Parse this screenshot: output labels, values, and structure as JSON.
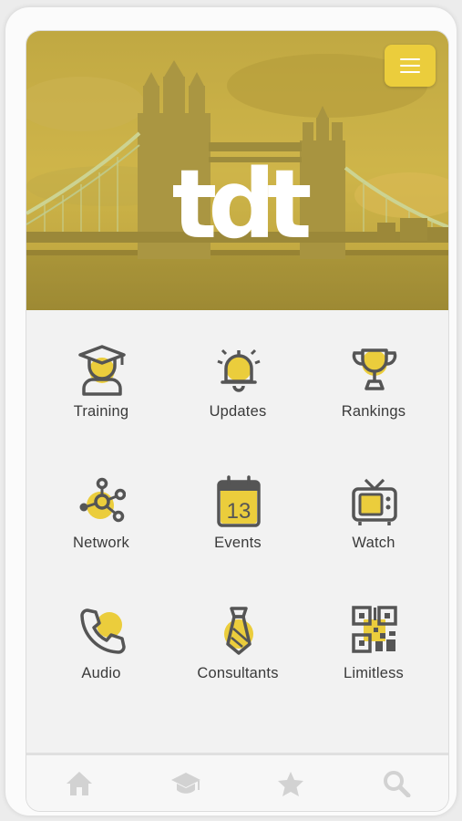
{
  "brand": {
    "logo_text": "tdt",
    "accent": "#ebcd3c",
    "icon_color": "#555555"
  },
  "header": {
    "menu_icon": "hamburger-menu-icon"
  },
  "tiles": [
    {
      "label": "Training",
      "icon": "graduate-icon"
    },
    {
      "label": "Updates",
      "icon": "bell-icon"
    },
    {
      "label": "Rankings",
      "icon": "trophy-icon"
    },
    {
      "label": "Network",
      "icon": "network-icon"
    },
    {
      "label": "Events",
      "icon": "calendar-icon",
      "calendar_day": "13"
    },
    {
      "label": "Watch",
      "icon": "tv-icon"
    },
    {
      "label": "Audio",
      "icon": "phone-icon"
    },
    {
      "label": "Consultants",
      "icon": "tie-icon"
    },
    {
      "label": "Limitless",
      "icon": "qr-code-icon"
    }
  ],
  "tabbar": [
    {
      "icon": "home-icon"
    },
    {
      "icon": "graduation-cap-icon"
    },
    {
      "icon": "star-icon"
    },
    {
      "icon": "search-icon"
    }
  ]
}
